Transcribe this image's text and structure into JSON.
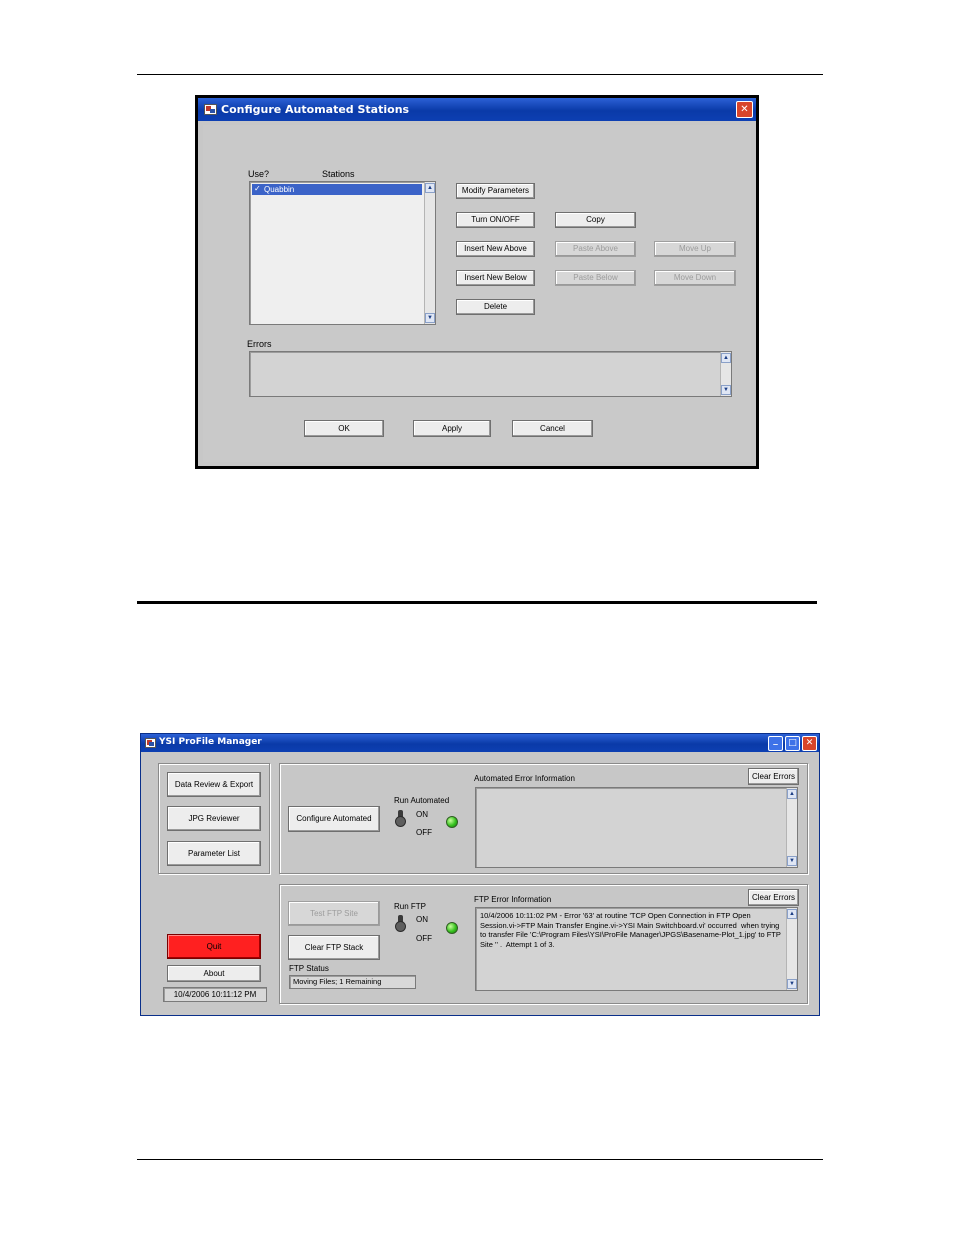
{
  "configure_dialog": {
    "title": "Configure Automated Stations",
    "close_glyph": "✕",
    "col_use_label": "Use?",
    "col_stations_label": "Stations",
    "stations": [
      {
        "check": "✓",
        "name": "Quabbin"
      }
    ],
    "buttons": {
      "modify_parameters": "Modify Parameters",
      "turn_on_off": "Turn ON/OFF",
      "copy": "Copy",
      "insert_new_above": "Insert New Above",
      "paste_above": "Paste Above",
      "move_up": "Move Up",
      "insert_new_below": "Insert New Below",
      "paste_below": "Paste Below",
      "move_down": "Move Down",
      "delete": "Delete",
      "ok": "OK",
      "apply": "Apply",
      "cancel": "Cancel"
    },
    "errors_label": "Errors",
    "errors_text": ""
  },
  "manager_window": {
    "title": "YSI ProFile Manager",
    "min_glyph": "_",
    "max_glyph": "□",
    "close_glyph": "✕",
    "nav": {
      "data_review": "Data Review & Export",
      "jpg_reviewer": "JPG Reviewer",
      "parameter_list": "Parameter List",
      "quit": "Quit",
      "about": "About",
      "clock": "10/4/2006 10:11:12 PM"
    },
    "automated": {
      "configure_button": "Configure Automated",
      "run_label": "Run Automated",
      "on_label": "ON",
      "off_label": "OFF",
      "error_label": "Automated Error Information",
      "clear_errors": "Clear Errors",
      "error_text": ""
    },
    "ftp": {
      "test_button": "Test FTP Site",
      "clear_stack_button": "Clear FTP Stack",
      "status_label": "FTP Status",
      "status_value": "Moving Files; 1 Remaining",
      "run_label": "Run FTP",
      "on_label": "ON",
      "off_label": "OFF",
      "error_label": "FTP Error Information",
      "clear_errors": "Clear Errors",
      "error_text": "10/4/2006 10:11:02 PM - Error '63' at routine 'TCP Open Connection in FTP Open Session.vi->FTP Main Transfer Engine.vi->YSI Main Switchboard.vi' occurred  when trying to transfer File 'C:\\Program Files\\YSI\\ProFile Manager\\JPGS\\Basename-Plot_1.jpg' to FTP Site '' .  Attempt 1 of 3."
    }
  },
  "colors": {
    "titlebar": "#0a3aa8",
    "dialog_bg": "#c7c7c7",
    "quit_red": "#ff2020",
    "selection_blue": "#3b63c8",
    "led_green": "#35c11e"
  }
}
